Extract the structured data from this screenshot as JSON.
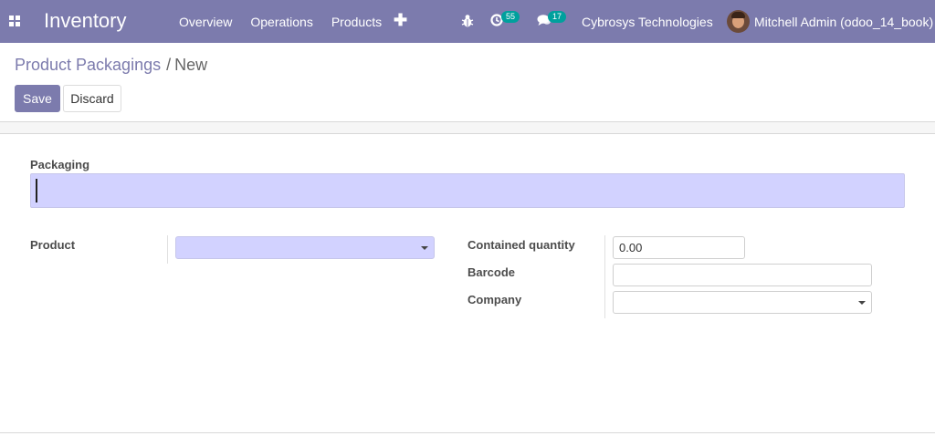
{
  "navbar": {
    "app_title": "Inventory",
    "menu": [
      "Overview",
      "Operations",
      "Products"
    ],
    "activity_count": "55",
    "messages_count": "17",
    "company": "Cybrosys Technologies",
    "user": "Mitchell Admin (odoo_14_book)",
    "color": "#7c7bad"
  },
  "breadcrumb": {
    "parent": "Product Packagings",
    "separator": "/",
    "current": "New"
  },
  "buttons": {
    "save": "Save",
    "discard": "Discard"
  },
  "form": {
    "packaging_label": "Packaging",
    "packaging_value": "",
    "product_label": "Product",
    "product_value": "",
    "contained_quantity_label": "Contained quantity",
    "contained_quantity_value": "0.00",
    "barcode_label": "Barcode",
    "barcode_value": "",
    "company_label": "Company",
    "company_value": ""
  },
  "icons": {
    "apps": "apps-grid-icon",
    "plus": "plus-icon",
    "bug": "bug-icon",
    "activity": "clock-icon",
    "chat": "chat-icon",
    "dropdown": "caret-down-icon"
  },
  "colors": {
    "required_field_bg": "#d2d2ff",
    "badge": "#00a09d"
  }
}
